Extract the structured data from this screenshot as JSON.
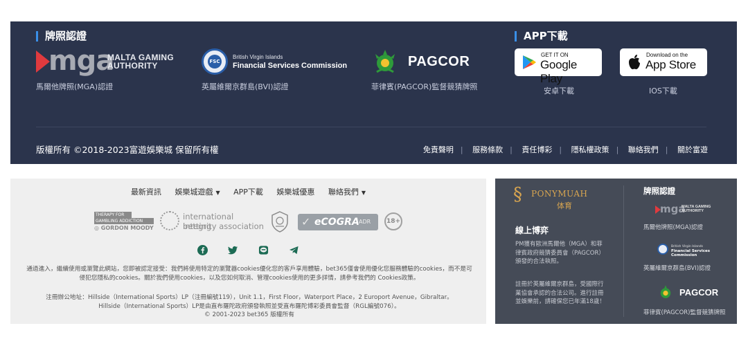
{
  "licenses": {
    "title": "牌照認證",
    "mga": {
      "word": "mga",
      "line1": "MALTA GAMING",
      "line2": "AUTHORITY",
      "caption": "馬爾他牌照(MGA)認證"
    },
    "bvi": {
      "seal_text": "FSC",
      "small": "British Virgin Islands",
      "big": "Financial Services Commission",
      "caption": "英屬維爾京群島(BVI)認證"
    },
    "pagcor": {
      "word": "PAGCOR",
      "caption": "菲律賓(PAGCOR)監督競猜牌照"
    }
  },
  "app": {
    "title": "APP下載",
    "google": {
      "small": "GET IT ON",
      "big": "Google Play",
      "caption": "安卓下載"
    },
    "apple": {
      "small": "Download on the",
      "big": "App Store",
      "caption": "IOS下載"
    }
  },
  "footer_top": {
    "copyright": "版權所有 ©2018-2023富遊娛樂城 保留所有權",
    "links": [
      "免責聲明",
      "服務條款",
      "責任博彩",
      "隱私權政策",
      "聯絡我們",
      "關於富遊"
    ]
  },
  "light_footer": {
    "menu": [
      {
        "label": "最新資訊",
        "caret": false
      },
      {
        "label": "娛樂城遊戲",
        "caret": true
      },
      {
        "label": "APP下載",
        "caret": false
      },
      {
        "label": "娛樂城優惠",
        "caret": false
      },
      {
        "label": "聯絡我們",
        "caret": true
      }
    ],
    "badges": {
      "gamble_l1": "THERAPY FOR",
      "gamble_l2": "GAMBLING ADDICTION",
      "gamble_l3": "◎ GORDON MOODY",
      "ibia_l1": "international betting",
      "ibia_l2": "integrity association",
      "ecogra": "eCOGRA",
      "ecogra_adr": "ADR",
      "age": "18+"
    },
    "socials": [
      "facebook-icon",
      "twitter-icon",
      "line-icon",
      "telegram-icon"
    ],
    "notice_l1": "通過進入，繼續使用或瀏覽此網站，您即被認定接受：我們將使用特定的瀏覽器cookies優化您的客戶享用體驗，bet365僅會使用優化您服務體驗的cookies，而不是可",
    "notice_l2": "侵犯您隱私的cookies。關於我們使用cookies，以及您如何取消、管理cookies使用的更多詳情，請參考我們的 Cookies政策。",
    "addr_l1": "注冊辦公地址：Hillside（International Sports）LP（注冊編號119），Unit 1.1，First Floor，Waterport Place，2 Europort Avenue，Gibraltar。",
    "addr_l2": "Hillside（International Sports）LP是由直布羅陀政府頒發執照並受直布羅陀博彩委員會監督（RGL編號076）。",
    "addr_l3": "© 2001-2023 bet365 版權所有"
  },
  "pm_panel": {
    "brand": "PONYMUAH",
    "brand_sub": "体育",
    "heading": "線上博弈",
    "p1": "PM獲有歐洲馬爾他（MGA）和菲律賓政府競猜委員會（PAGCOR）頒發的合法執照。",
    "p2": "註冊於英屬維爾京群島，受國際行業協會承認的合法公司。進行註冊並娛樂前，請確保您已年滿18歲！",
    "licenses_title": "牌照認證",
    "mga_caption": "馬爾他牌照(MGA)認證",
    "bvi_caption": "英屬維爾京群島(BVI)認證",
    "pagcor_word": "PAGCOR",
    "pagcor_caption": "菲律賓(PAGCOR)監督競猜牌照",
    "mini_mga_word": "mga",
    "mini_mga_l1": "MALTA GAMING",
    "mini_mga_l2": "AUTHORITY",
    "mini_bvi_small": "British Virgin Islands",
    "mini_bvi_big": "Financial Services Commission"
  },
  "colors": {
    "top_bg": "#2b344c",
    "accent_bar": "#3a8fe8",
    "mga_red": "#e03a3e",
    "pm_gold": "#d8a550",
    "pm_bg": "#454b57"
  }
}
